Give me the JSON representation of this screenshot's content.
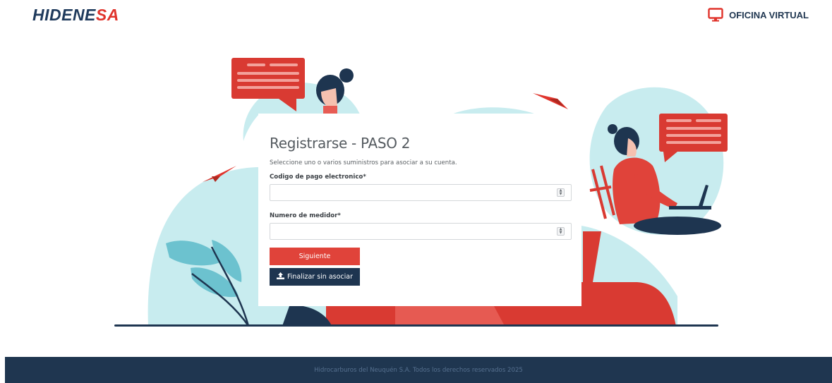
{
  "header": {
    "logo_part1": "HIDENE",
    "logo_part2": "SA",
    "oficina_label": "OFICINA VIRTUAL"
  },
  "form": {
    "title": "Registrarse - PASO 2",
    "subtitle": "Seleccione uno o varios suministros para asociar a su cuenta.",
    "field1": {
      "label": "Codigo de pago electronico*",
      "value": "",
      "placeholder": ""
    },
    "field2": {
      "label": "Numero de medidor*",
      "value": "",
      "placeholder": ""
    },
    "next_button": "Siguiente",
    "skip_button": "Finalizar sin asociar",
    "skip_icon": "upload-icon"
  },
  "footer": {
    "text": "Hidrocarburos del Neuquén S.A. Todos los derechos reservados 2025"
  },
  "colors": {
    "brand_navy": "#1e3550",
    "brand_red": "#e0342c",
    "accent_cyan": "#c8ecef"
  }
}
